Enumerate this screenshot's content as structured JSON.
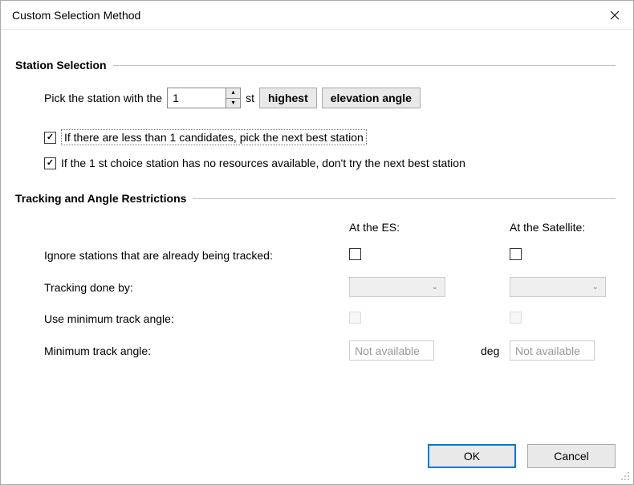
{
  "window": {
    "title": "Custom Selection Method"
  },
  "station_selection": {
    "header": "Station Selection",
    "prefix": "Pick the station with the",
    "value": "1",
    "suffix": "st",
    "btn_highest": "highest",
    "btn_elevation": "elevation angle",
    "cb1_checked": true,
    "cb1_label": "If there are less than 1 candidates, pick the next best station",
    "cb2_checked": true,
    "cb2_label": "If the 1 st choice station has no resources available, don't try the next best station"
  },
  "tracking": {
    "header": "Tracking and Angle Restrictions",
    "col_es": "At the ES:",
    "col_sat": "At the Satellite:",
    "row1": "Ignore stations that are already being tracked:",
    "row2": "Tracking done by:",
    "row3": "Use minimum track angle:",
    "row4": "Minimum track angle:",
    "na": "Not available",
    "deg": "deg"
  },
  "buttons": {
    "ok": "OK",
    "cancel": "Cancel"
  }
}
